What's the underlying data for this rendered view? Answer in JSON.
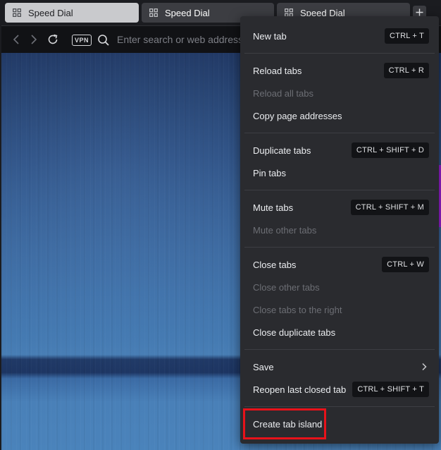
{
  "tabs": [
    {
      "title": "Speed Dial",
      "icon": "grid-icon",
      "state": "active"
    },
    {
      "title": "Speed Dial",
      "icon": "grid-icon",
      "state": "inactive"
    },
    {
      "title": "Speed Dial",
      "icon": "grid-icon",
      "state": "inactive"
    }
  ],
  "toolbar": {
    "new_tab_icon": "plus-icon",
    "vpn_label": "VPN",
    "address_placeholder": "Enter search or web address"
  },
  "context_menu": {
    "new_tab": {
      "label": "New tab",
      "shortcut": "CTRL + T"
    },
    "reload_tabs": {
      "label": "Reload tabs",
      "shortcut": "CTRL + R"
    },
    "reload_all_tabs": {
      "label": "Reload all tabs",
      "disabled": true
    },
    "copy_page_addresses": {
      "label": "Copy page addresses"
    },
    "duplicate_tabs": {
      "label": "Duplicate tabs",
      "shortcut": "CTRL + SHIFT + D"
    },
    "pin_tabs": {
      "label": "Pin tabs"
    },
    "mute_tabs": {
      "label": "Mute tabs",
      "shortcut": "CTRL + SHIFT + M"
    },
    "mute_other_tabs": {
      "label": "Mute other tabs",
      "disabled": true
    },
    "close_tabs": {
      "label": "Close tabs",
      "shortcut": "CTRL + W"
    },
    "close_other_tabs": {
      "label": "Close other tabs",
      "disabled": true
    },
    "close_tabs_right": {
      "label": "Close tabs to the right",
      "disabled": true
    },
    "close_duplicate_tabs": {
      "label": "Close duplicate tabs"
    },
    "save": {
      "label": "Save",
      "icon": "chevron-right-icon"
    },
    "reopen_last_closed": {
      "label": "Reopen last closed tab",
      "shortcut": "CTRL + SHIFT + T"
    },
    "create_tab_island": {
      "label": "Create tab island",
      "highlighted": true
    }
  },
  "colors": {
    "menu_background": "#2a2b2f",
    "highlight_border": "#e8121a",
    "accent_purple": "#9b1fd6"
  }
}
